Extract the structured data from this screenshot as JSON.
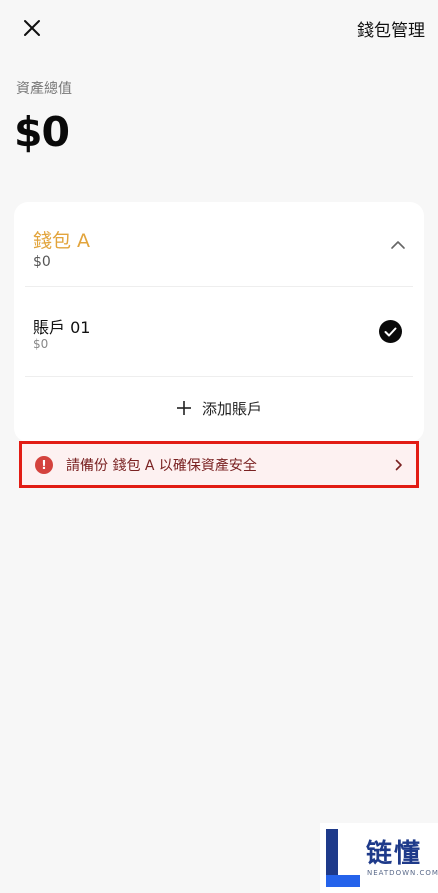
{
  "header": {
    "close_icon": "close-icon",
    "title": "錢包管理"
  },
  "assets": {
    "label": "資產總值",
    "total": "$0"
  },
  "wallet": {
    "name": "錢包 A",
    "balance": "$0",
    "expanded": true,
    "accent_color": "#e2a43c",
    "accounts": [
      {
        "name": "賬戶 01",
        "balance": "$0",
        "selected": true
      }
    ],
    "add_account_label": "添加賬戶"
  },
  "backup_banner": {
    "text": "請備份 錢包 A 以確保資產安全",
    "highlight_color": "#e21c14",
    "icon": "alert-icon"
  },
  "watermark": {
    "logo_letter": "L",
    "chinese": "链懂",
    "english": "NEATDOWN.COM"
  }
}
